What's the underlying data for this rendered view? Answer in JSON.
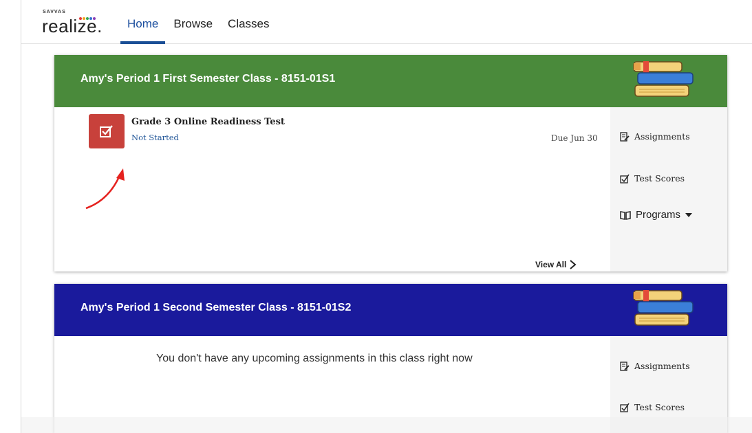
{
  "brand": {
    "small": "SAVVAS",
    "main": "realize.",
    "dot_colors": [
      "#e23a3a",
      "#f2a31b",
      "#34a853",
      "#2f6fd1",
      "#8b3fb5"
    ]
  },
  "nav": {
    "items": [
      {
        "label": "Home",
        "active": true
      },
      {
        "label": "Browse",
        "active": false
      },
      {
        "label": "Classes",
        "active": false
      }
    ]
  },
  "classes": [
    {
      "title": "Amy's Period 1 First Semester Class - 8151-01S1",
      "header_color": "#4a8a3b",
      "assignment": {
        "title": "Grade 3 Online Readiness Test",
        "status": "Not Started",
        "due": "Due Jun 30",
        "icon": "checkbox-icon"
      },
      "view_all": "View All",
      "sidebar": {
        "assignments": "Assignments",
        "test_scores": "Test Scores",
        "programs": "Programs"
      }
    },
    {
      "title": "Amy's Period 1 Second Semester Class - 8151-01S2",
      "header_color": "#1a1a9c",
      "empty_message": "You don't have any upcoming assignments in this class right now",
      "sidebar": {
        "assignments": "Assignments",
        "test_scores": "Test Scores"
      }
    }
  ],
  "colors": {
    "assignment_icon_bg": "#c8413b",
    "status_blue": "#1f5497",
    "nav_active": "#1a4f96",
    "annotation_arrow": "#e5221f"
  }
}
